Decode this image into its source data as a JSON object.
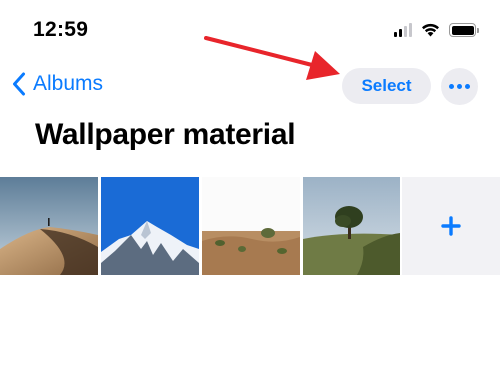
{
  "status_bar": {
    "time": "12:59",
    "icons": [
      "cellular-signal-icon",
      "wifi-icon",
      "battery-icon"
    ]
  },
  "nav": {
    "back_label": "Albums",
    "back_icon": "chevron-left-icon",
    "select_label": "Select",
    "more_icon": "ellipsis-icon"
  },
  "album": {
    "title": "Wallpaper material",
    "photos": [
      {
        "subject": "desert dunes with lone figure"
      },
      {
        "subject": "snowy mountain peak under blue sky"
      },
      {
        "subject": "desert shrubs and dunes"
      },
      {
        "subject": "tree on green hillside"
      }
    ],
    "add_icon": "plus-icon"
  },
  "colors": {
    "accent": "#0a7bff",
    "button_bg": "#ececf1",
    "annotation_arrow": "#e8252b"
  }
}
